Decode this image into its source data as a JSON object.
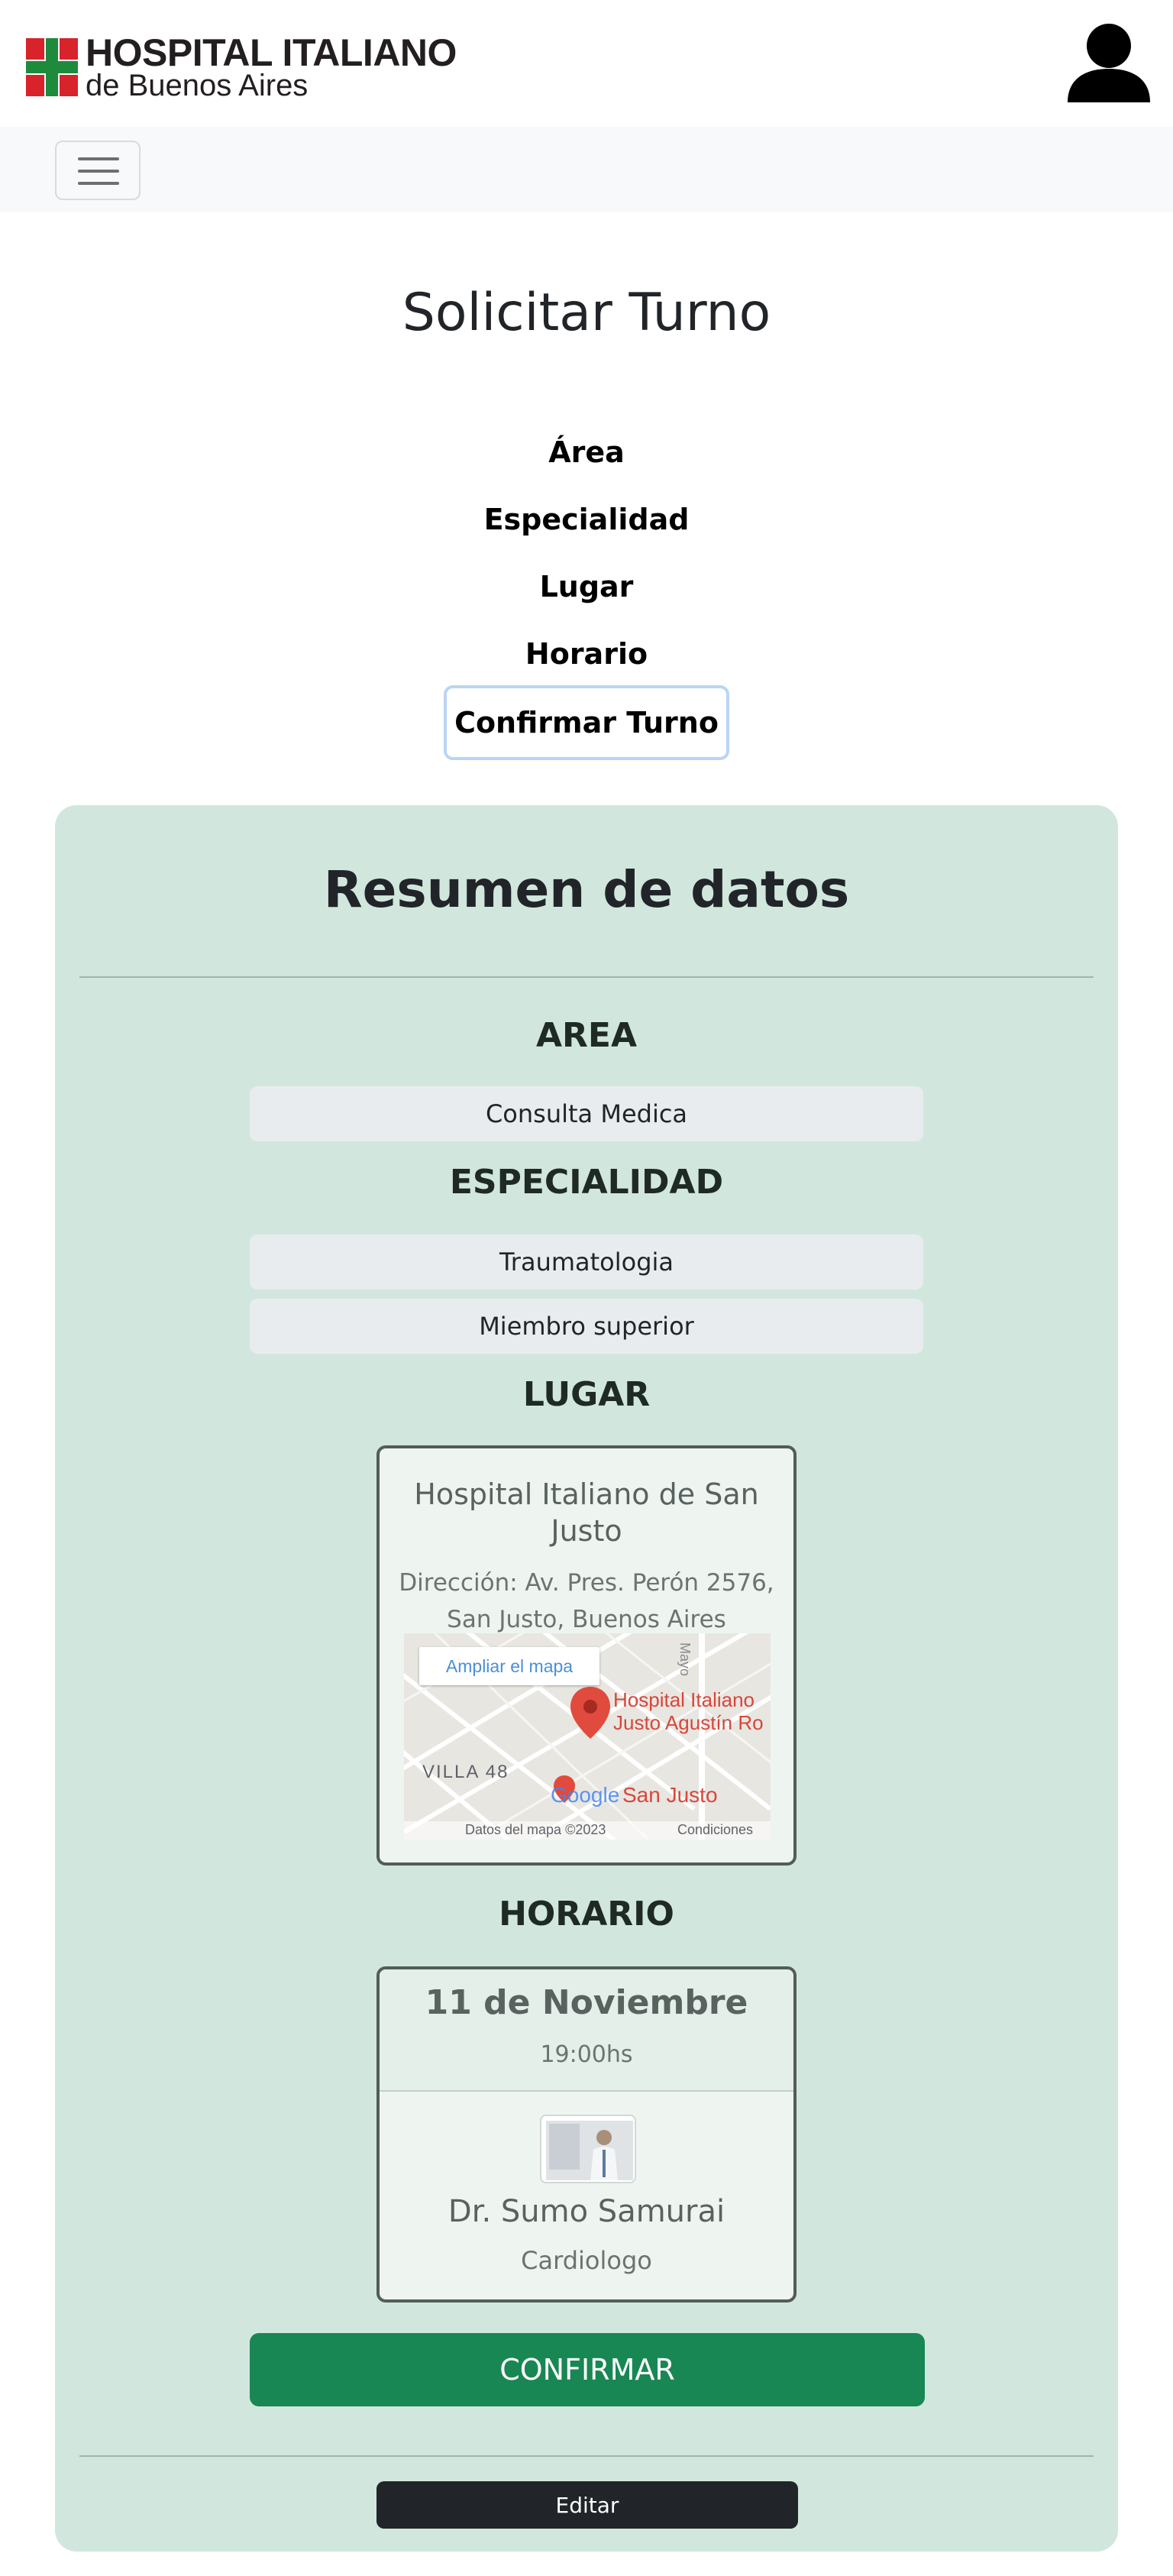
{
  "header": {
    "logo": {
      "line1": "HOSPITAL ITALIANO",
      "line2": "de Buenos Aires",
      "cross_red": "#d8232a",
      "cross_green": "#1e8a3c"
    },
    "user_icon": "user-icon",
    "menu_icon": "hamburger-menu-icon"
  },
  "page": {
    "title": "Solicitar Turno",
    "steps": [
      "Área",
      "Especialidad",
      "Lugar",
      "Horario"
    ],
    "active_step": "Confirmar Turno"
  },
  "summary": {
    "title": "Resumen de datos",
    "area": {
      "heading": "AREA",
      "value": "Consulta Medica"
    },
    "especialidad": {
      "heading": "ESPECIALIDAD",
      "values": [
        "Traumatologia",
        "Miembro superior"
      ]
    },
    "lugar": {
      "heading": "LUGAR",
      "name": "Hospital Italiano de San Justo",
      "address": "Dirección: Av. Pres. Perón 2576, San Justo, Buenos Aires",
      "map": {
        "enlarge_label": "Ampliar el mapa",
        "place_label_1": "Hospital Italiano",
        "place_label_2": "Justo Agustín Ro",
        "neighborhood": "VILLA 48",
        "city_label": "San Justo",
        "street_label": "Mayo",
        "google_label": "Google",
        "data_label": "Datos del mapa ©2023",
        "terms_label": "Condiciones"
      }
    },
    "horario": {
      "heading": "HORARIO",
      "date": "11 de Noviembre",
      "time": "19:00hs",
      "doctor_name": "Dr. Sumo Samurai",
      "doctor_specialty": "Cardiologo"
    },
    "confirm_label": "CONFIRMAR",
    "edit_label": "Editar"
  },
  "colors": {
    "summary_bg": "#d1e7dd",
    "confirm_bg": "#198754",
    "edit_bg": "#212529",
    "active_step_border": "#b9d5f5"
  }
}
